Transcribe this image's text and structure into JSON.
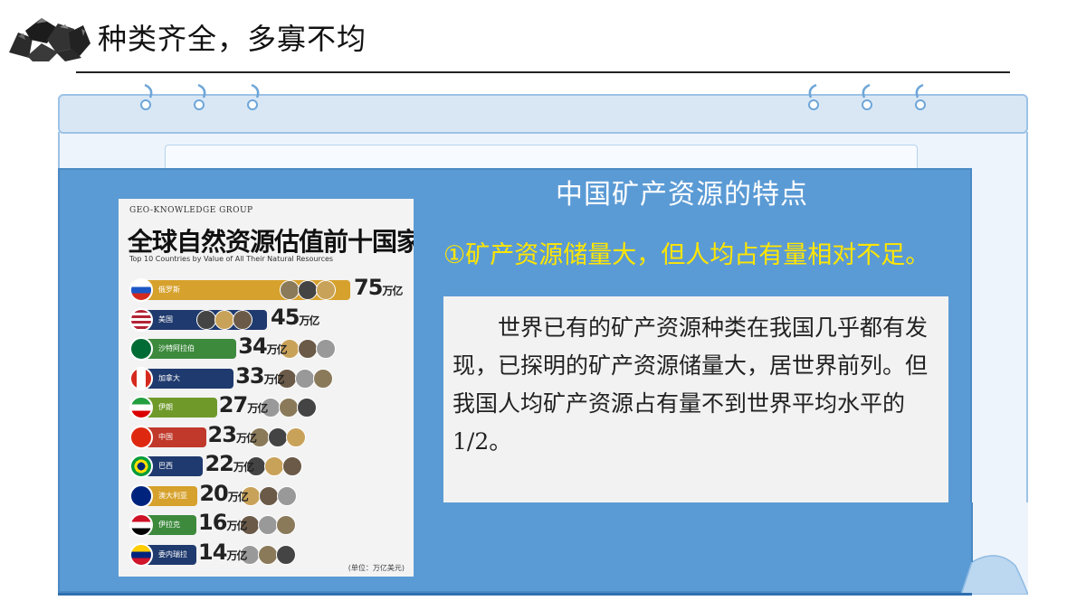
{
  "header": {
    "title": "种类齐全，多寡不均"
  },
  "content": {
    "main_heading": "中国矿产资源的特点",
    "sub_heading": "①矿产资源储量大，但人均占有量相对不足。",
    "paragraph": "世界已有的矿产资源种类在我国几乎都有发现，已探明的矿产资源储量大，居世界前列。但我国人均矿产资源占有量不到世界平均水平的1/2。"
  },
  "infographic": {
    "group": "GEO-KNOWLEDGE GROUP",
    "title": "全球自然资源估值前十国家",
    "subtitle": "Top 10 Countries by Value of All Their Natural Resources",
    "unit_note": "(单位：万亿美元)",
    "unit_suffix": "万亿",
    "rows": [
      {
        "country": "俄罗斯",
        "value": "75",
        "bar_color": "#d6a12c",
        "flag": "russia"
      },
      {
        "country": "美国",
        "value": "45",
        "bar_color": "#1f3a6e",
        "flag": "usa"
      },
      {
        "country": "沙特阿拉伯",
        "value": "34",
        "bar_color": "#3d8a3d",
        "flag": "saudi"
      },
      {
        "country": "加拿大",
        "value": "33",
        "bar_color": "#1f3a6e",
        "flag": "canada"
      },
      {
        "country": "伊朗",
        "value": "27",
        "bar_color": "#6f9a2a",
        "flag": "iran"
      },
      {
        "country": "中国",
        "value": "23",
        "bar_color": "#c0392b",
        "flag": "china"
      },
      {
        "country": "巴西",
        "value": "22",
        "bar_color": "#1f3a6e",
        "flag": "brazil"
      },
      {
        "country": "澳大利亚",
        "value": "20",
        "bar_color": "#d6a12c",
        "flag": "australia"
      },
      {
        "country": "伊拉克",
        "value": "16",
        "bar_color": "#3d8a3d",
        "flag": "iraq"
      },
      {
        "country": "委内瑞拉",
        "value": "14",
        "bar_color": "#1f3a6e",
        "flag": "venezuela"
      }
    ]
  }
}
